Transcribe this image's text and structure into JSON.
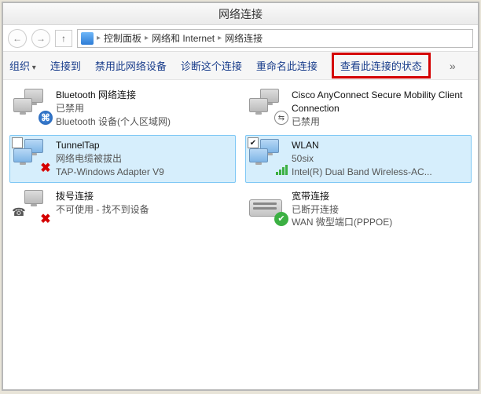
{
  "window": {
    "title": "网络连接"
  },
  "breadcrumb": {
    "part1": "控制面板",
    "part2": "网络和 Internet",
    "part3": "网络连接"
  },
  "toolbar": {
    "organize": "组织",
    "connect_to": "连接到",
    "disable_device": "禁用此网络设备",
    "diagnose": "诊断这个连接",
    "rename": "重命名此连接",
    "view_status": "查看此连接的状态"
  },
  "connections": {
    "bt": {
      "name": "Bluetooth 网络连接",
      "status": "已禁用",
      "device": "Bluetooth 设备(个人区域网)"
    },
    "cisco": {
      "name": "Cisco AnyConnect Secure Mobility Client Connection",
      "status": "已禁用",
      "device": ""
    },
    "tunnel": {
      "name": "TunnelTap",
      "status": "网络电缆被拔出",
      "device": "TAP-Windows Adapter V9"
    },
    "wlan": {
      "name": "WLAN",
      "status": "50six",
      "device": "Intel(R) Dual Band Wireless-AC..."
    },
    "dial": {
      "name": "拨号连接",
      "status": "不可使用 - 找不到设备",
      "device": ""
    },
    "bb": {
      "name": "宽带连接",
      "status": "已断开连接",
      "device": "WAN 微型端口(PPPOE)"
    }
  }
}
